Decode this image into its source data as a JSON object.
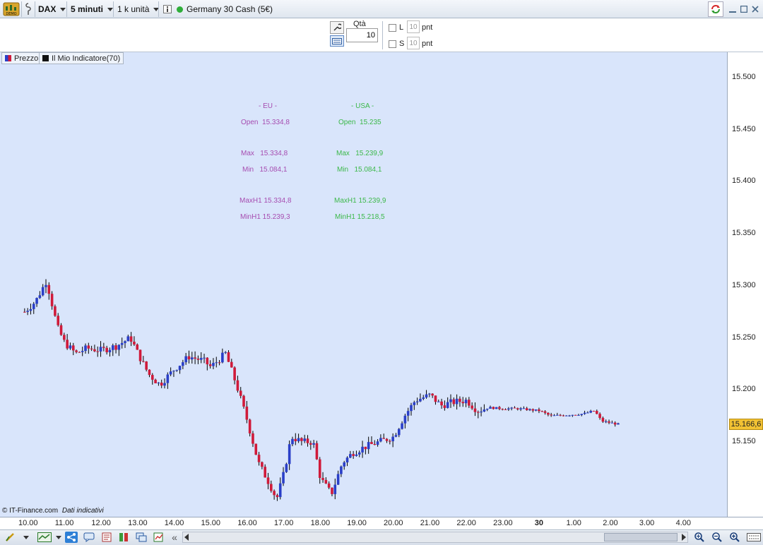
{
  "toolbar": {
    "demo_label": "DEMO",
    "symbol": "DAX",
    "timeframe": "5 minuti",
    "units": "1 k unità",
    "instrument": "Germany 30 Cash (5€)",
    "status_color": "#2fae3a"
  },
  "order": {
    "qty_label": "Qtà",
    "qty_value": "10",
    "long_label": "L",
    "long_value": "10",
    "short_label": "S",
    "short_value": "10",
    "unit": "pnt"
  },
  "legend": {
    "price": "Prezzo",
    "indicator": "Il Mio Indicatore(70)"
  },
  "info": {
    "eu": {
      "title": "- EU -",
      "open": "Open  15.334,8",
      "max": "Max   15.334,8",
      "min": "Min   15.084,1",
      "maxh1": "MaxH1 15.334,8",
      "minh1": "MinH1 15.239,3"
    },
    "usa": {
      "title": "- USA -",
      "open": "Open  15.235",
      "max": "Max   15.239,9",
      "min": "Min   15.084,1",
      "maxh1": "MaxH1 15.239,9",
      "minh1": "MinH1 15.218,5"
    }
  },
  "footer": {
    "copyright": "© IT-Finance.com",
    "note": "Dati indicativi"
  },
  "chart_data": {
    "type": "candlestick",
    "price_ticks": [
      "15.500",
      "15.450",
      "15.400",
      "15.350",
      "15.300",
      "15.250",
      "15.200",
      "15.150"
    ],
    "price_tick_values": [
      15500,
      15450,
      15400,
      15350,
      15300,
      15250,
      15200,
      15150
    ],
    "current_price_label": "15.166,6",
    "current_price": 15166.6,
    "time_ticks": [
      "10.00",
      "11.00",
      "12.00",
      "13.00",
      "14.00",
      "15.00",
      "16.00",
      "17.00",
      "18.00",
      "19.00",
      "20.00",
      "21.00",
      "22.00",
      "23.00",
      "30",
      "1.00",
      "2.00",
      "3.00",
      "4.00"
    ],
    "close_path": [
      [
        9.9,
        15275
      ],
      [
        10.2,
        15285
      ],
      [
        10.5,
        15305
      ],
      [
        10.8,
        15260
      ],
      [
        11.0,
        15245
      ],
      [
        11.3,
        15235
      ],
      [
        11.6,
        15240
      ],
      [
        12.0,
        15238
      ],
      [
        12.4,
        15242
      ],
      [
        12.8,
        15250
      ],
      [
        13.0,
        15235
      ],
      [
        13.3,
        15215
      ],
      [
        13.6,
        15205
      ],
      [
        14.0,
        15220
      ],
      [
        14.4,
        15232
      ],
      [
        14.8,
        15228
      ],
      [
        15.0,
        15222
      ],
      [
        15.4,
        15235
      ],
      [
        15.7,
        15205
      ],
      [
        16.0,
        15170
      ],
      [
        16.3,
        15130
      ],
      [
        16.6,
        15110
      ],
      [
        16.8,
        15095
      ],
      [
        17.0,
        15120
      ],
      [
        17.2,
        15155
      ],
      [
        17.5,
        15150
      ],
      [
        17.8,
        15150
      ],
      [
        18.0,
        15115
      ],
      [
        18.3,
        15100
      ],
      [
        18.6,
        15130
      ],
      [
        18.9,
        15140
      ],
      [
        19.2,
        15145
      ],
      [
        19.6,
        15150
      ],
      [
        20.0,
        15155
      ],
      [
        20.3,
        15175
      ],
      [
        20.6,
        15190
      ],
      [
        21.0,
        15195
      ],
      [
        21.3,
        15185
      ],
      [
        21.6,
        15188
      ],
      [
        22.0,
        15190
      ],
      [
        22.3,
        15180
      ],
      [
        22.6,
        15183
      ],
      [
        23.0,
        15182
      ],
      [
        23.4,
        15182
      ],
      [
        24.0,
        15180
      ],
      [
        24.3,
        15175
      ],
      [
        24.8,
        15176
      ],
      [
        25.2,
        15177
      ],
      [
        25.5,
        15180
      ],
      [
        25.7,
        15170
      ],
      [
        26.0,
        15168
      ],
      [
        26.2,
        15166.6
      ]
    ]
  }
}
